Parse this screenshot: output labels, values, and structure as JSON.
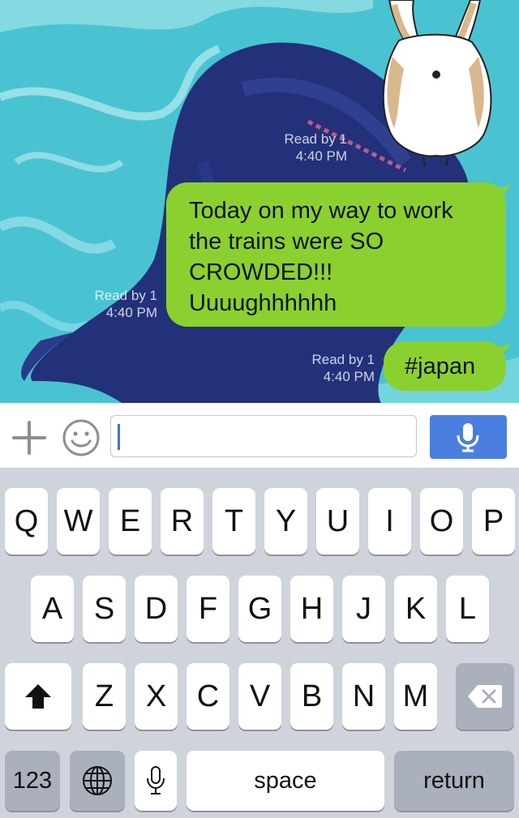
{
  "messages": [
    {
      "meta_line1": "Read by 1",
      "meta_line2": "4:40 PM",
      "type": "sticker",
      "sticker_icon": "corgi-butt-sticker"
    },
    {
      "meta_line1": "Read by 1",
      "meta_line2": "4:40 PM",
      "text_lines": [
        "Today on my way to work",
        "the trains were SO",
        "CROWDED!!!",
        "Uuuughhhhhh"
      ]
    },
    {
      "meta_line1": "Read by 1",
      "meta_line2": "4:40 PM",
      "text": "#japan"
    }
  ],
  "input": {
    "value": ""
  },
  "keyboard": {
    "row1": [
      "Q",
      "W",
      "E",
      "R",
      "T",
      "Y",
      "U",
      "I",
      "O",
      "P"
    ],
    "row2": [
      "A",
      "S",
      "D",
      "F",
      "G",
      "H",
      "J",
      "K",
      "L"
    ],
    "row3": [
      "Z",
      "X",
      "C",
      "V",
      "B",
      "N",
      "M"
    ],
    "numbers_label": "123",
    "space_label": "space",
    "return_label": "return"
  },
  "colors": {
    "bubble": "#8ad12f",
    "accent": "#4a7fe0"
  }
}
